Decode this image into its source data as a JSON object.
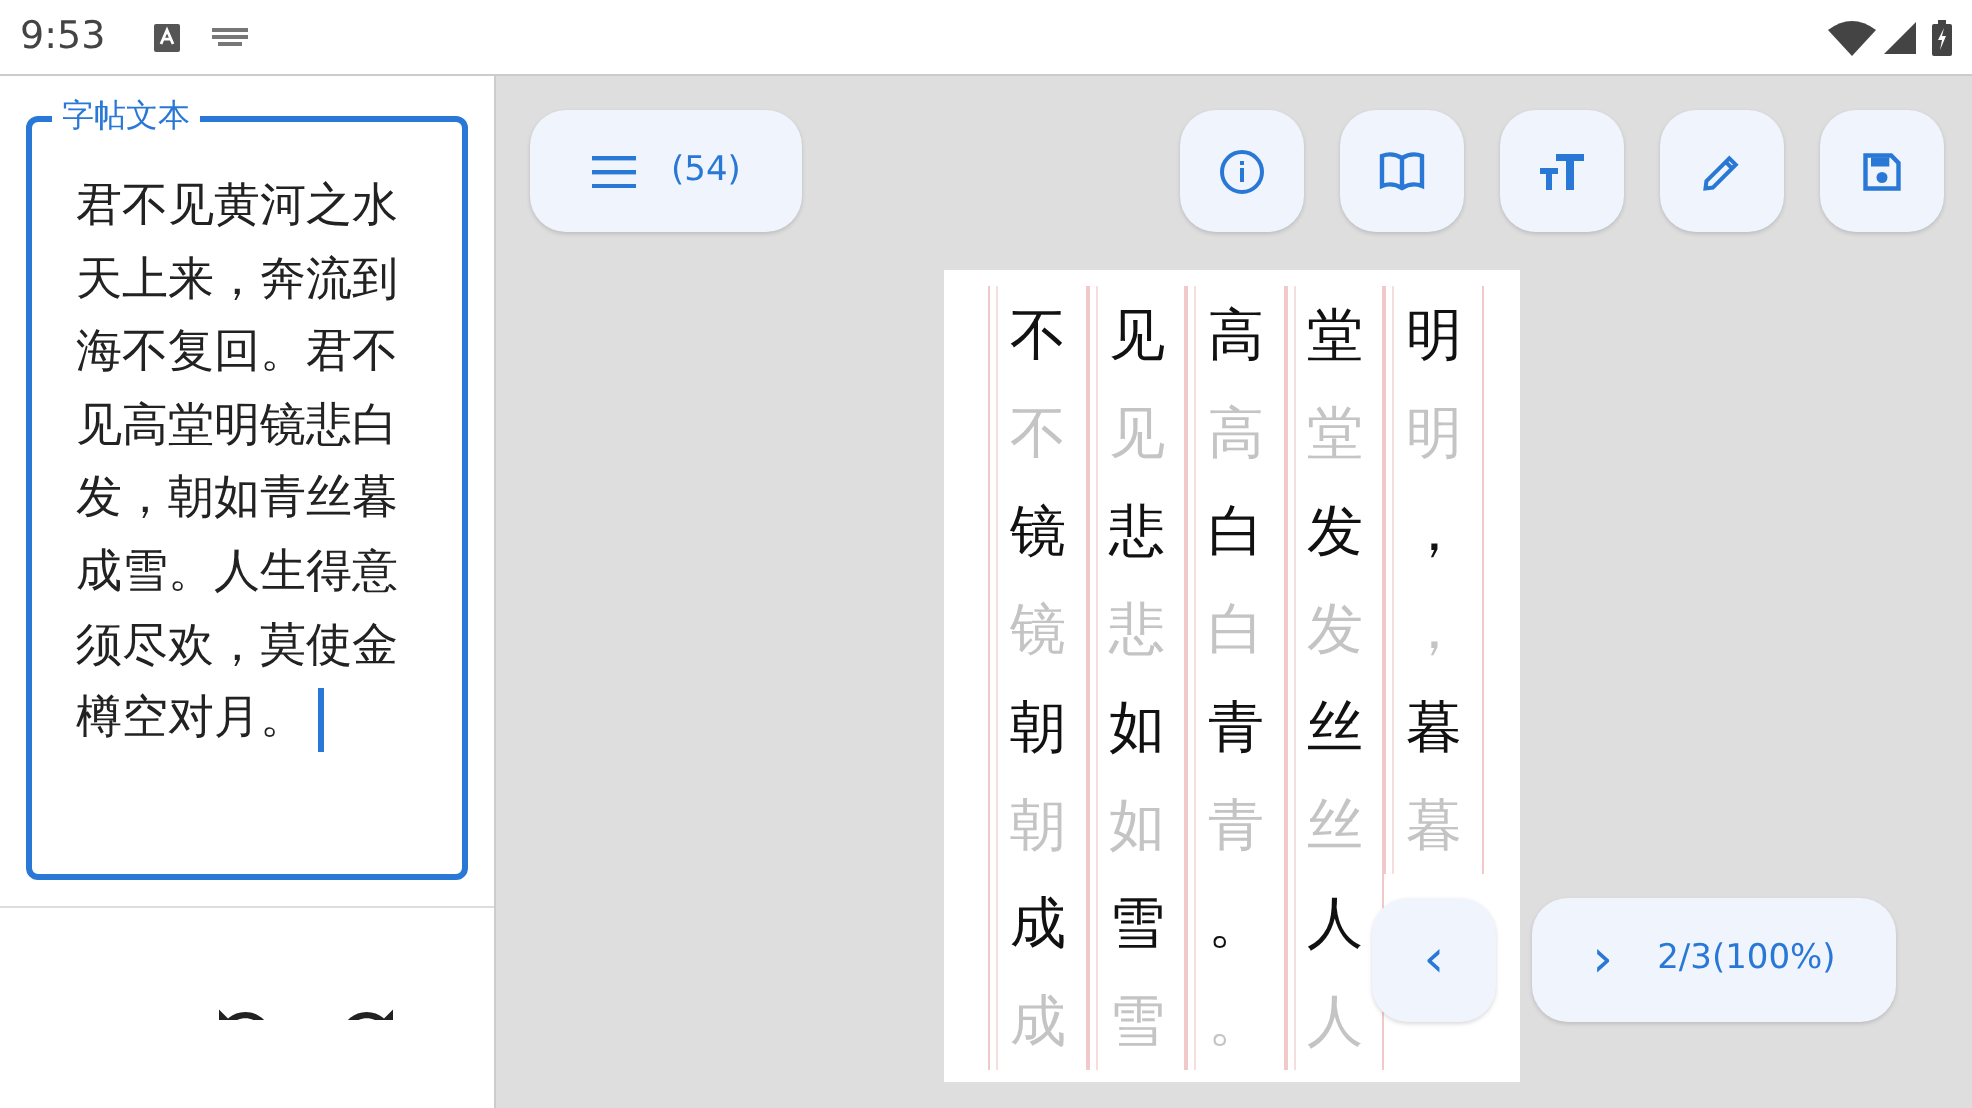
{
  "status_bar": {
    "time": "9:53"
  },
  "text_field": {
    "label": "字帖文本",
    "value": "君不见黄河之水天上来，奔流到海不复回。君不见高堂明镜悲白发，朝如青丝暮成雪。人生得意须尽欢，莫使金樽空对月。",
    "focused": true
  },
  "toolbar": {
    "menu_count": "(54)"
  },
  "sheet": {
    "rows": [
      {
        "chars": [
          "不",
          "见",
          "高",
          "堂",
          "明"
        ],
        "kind": "sample"
      },
      {
        "chars": [
          "不",
          "见",
          "高",
          "堂",
          "明"
        ],
        "kind": "trace"
      },
      {
        "chars": [
          "镜",
          "悲",
          "白",
          "发",
          "，"
        ],
        "kind": "sample"
      },
      {
        "chars": [
          "镜",
          "悲",
          "白",
          "发",
          "，"
        ],
        "kind": "trace"
      },
      {
        "chars": [
          "朝",
          "如",
          "青",
          "丝",
          "暮"
        ],
        "kind": "sample"
      },
      {
        "chars": [
          "朝",
          "如",
          "青",
          "丝",
          "暮"
        ],
        "kind": "trace"
      },
      {
        "chars": [
          "成",
          "雪",
          "。",
          "人"
        ],
        "kind": "sample"
      },
      {
        "chars": [
          "成",
          "雪",
          "。",
          "人"
        ],
        "kind": "trace"
      }
    ]
  },
  "pager": {
    "prev": "‹",
    "next": "›",
    "page": "2/3(100%)"
  }
}
